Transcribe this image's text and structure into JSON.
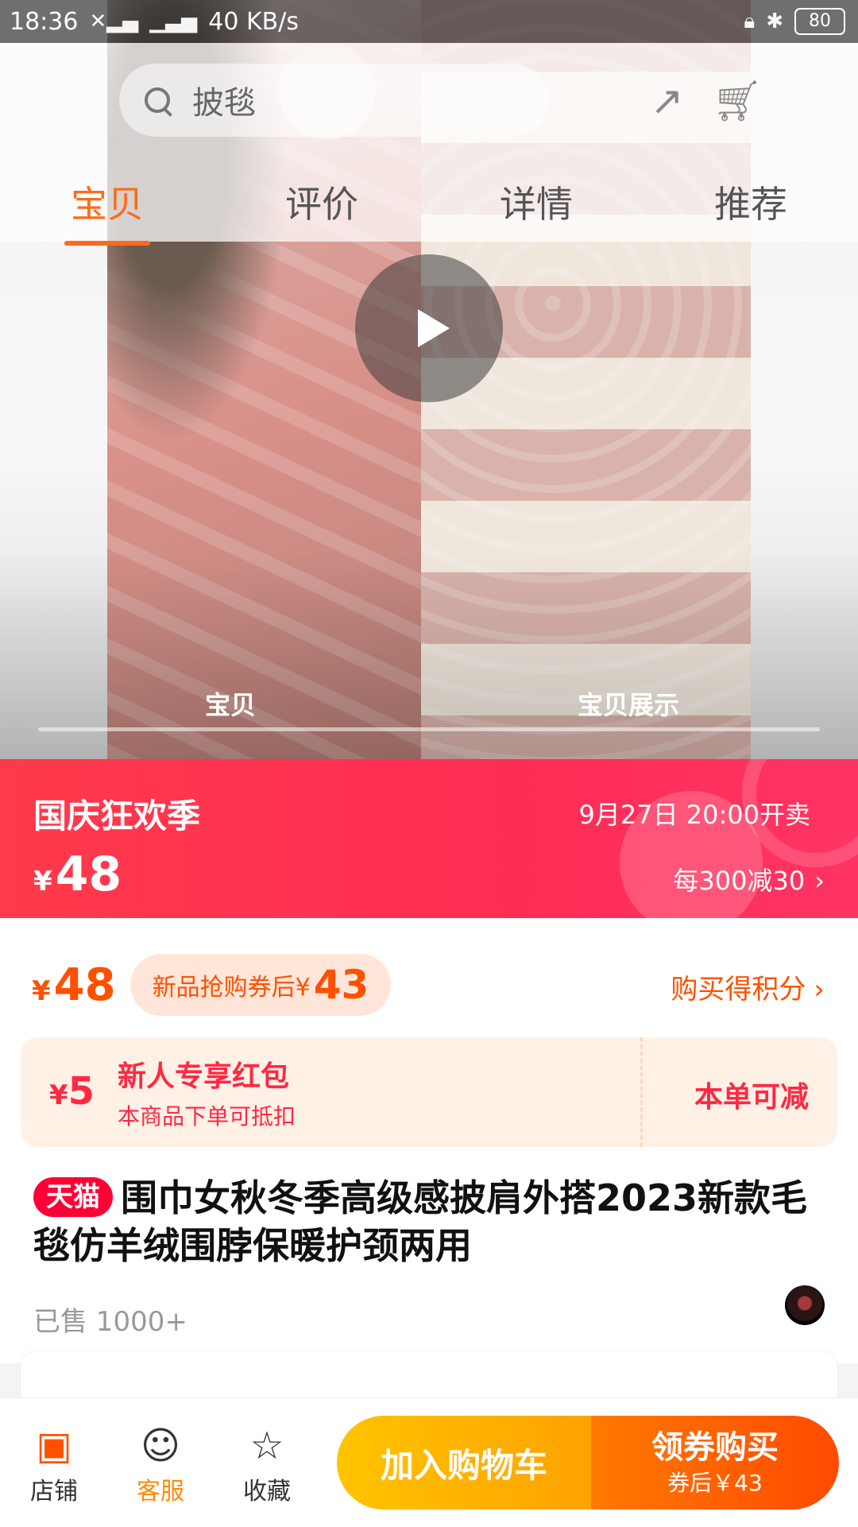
{
  "status_bar": {
    "time": "18:36",
    "network_speed": "40 KB/s",
    "battery": "80"
  },
  "search": {
    "placeholder": "披毯"
  },
  "tabs": [
    {
      "label": "宝贝"
    },
    {
      "label": "评价"
    },
    {
      "label": "详情"
    },
    {
      "label": "推荐"
    }
  ],
  "video": {
    "tab_left": "宝贝",
    "tab_right": "宝贝展示"
  },
  "promo": {
    "title": "国庆狂欢季",
    "start_time": "9月27日 20:00开卖",
    "currency": "¥",
    "price": "48",
    "discount": "每300减30",
    "chevron": "›"
  },
  "price": {
    "currency": "¥",
    "value": "48",
    "coupon_label": "新品抢购券后¥",
    "coupon_after_price": "43",
    "points_link": "购买得积分",
    "chevron": "›"
  },
  "red_packet": {
    "currency": "¥",
    "amount": "5",
    "title": "新人专享红包",
    "subtitle": "本商品下单可抵扣",
    "action": "本单可减"
  },
  "product": {
    "badge": "天猫",
    "title": "围巾女秋冬季高级感披肩外搭2023新款毛毯仿羊绒围脖保暖护颈两用",
    "sold": "已售 1000+"
  },
  "bottom_bar": {
    "shop_label": "店铺",
    "service_label": "客服",
    "favorite_label": "收藏",
    "add_to_cart": "加入购物车",
    "buy_label": "领券购买",
    "buy_sub": "券后￥43"
  },
  "colors": {
    "accent_orange": "#ff5000",
    "promo_red": "#ff2d55",
    "tmall_red": "#ff0036"
  },
  "icons": {
    "shop": "shop-icon",
    "service": "service-icon",
    "favorite": "star-icon",
    "search": "search-icon",
    "play": "play-icon"
  }
}
